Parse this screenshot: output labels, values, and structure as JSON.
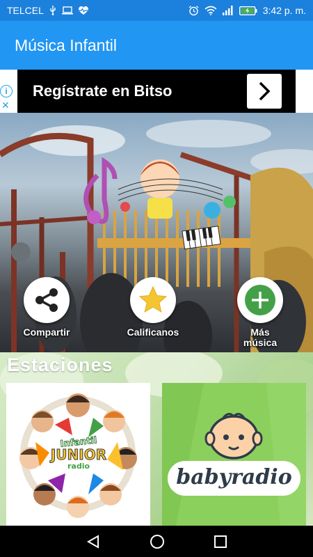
{
  "status_bar": {
    "carrier": "TELCEL",
    "time": "3:42 p. m."
  },
  "app_bar": {
    "title": "Música Infantil"
  },
  "ad": {
    "info_label": "i",
    "close_label": "✕",
    "text": "Regístrate en Bitso"
  },
  "actions": [
    {
      "label": "Compartir",
      "icon": "share-icon"
    },
    {
      "label": "Calificanos",
      "icon": "star-icon"
    },
    {
      "label": "Más música",
      "icon": "plus-icon"
    }
  ],
  "stations": {
    "title": "Estaciones",
    "items": [
      {
        "logo_text_1": "Infantil",
        "logo_text_2": "JUNIOR",
        "logo_text_3": "radio"
      },
      {
        "logo_text": "babyradio"
      }
    ]
  },
  "colors": {
    "status_bar": "#1c80dd",
    "app_bar": "#2196f3",
    "accent_green": "#43a047",
    "star_yellow": "#f4c531"
  }
}
